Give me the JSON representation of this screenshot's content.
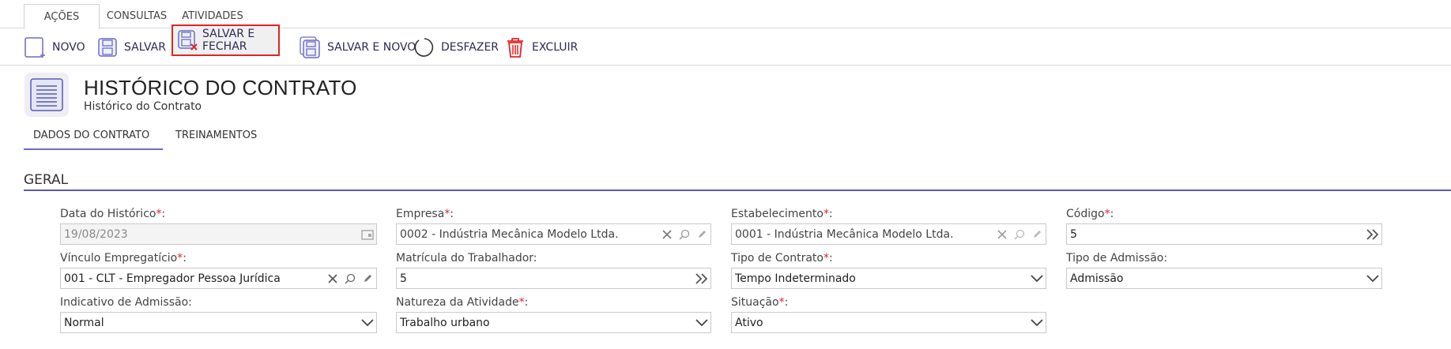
{
  "top_tabs": [
    "AÇÕES",
    "CONSULTAS",
    "ATIVIDADES"
  ],
  "toolbar": {
    "novo": "NOVO",
    "salvar": "SALVAR",
    "salvar_fechar": "SALVAR E FECHAR",
    "salvar_novo": "SALVAR E NOVO",
    "desfazer": "DESFAZER",
    "excluir": "EXCLUIR"
  },
  "header": {
    "title": "HISTÓRICO DO CONTRATO",
    "subtitle": "Histórico do Contrato"
  },
  "section_tabs": [
    "DADOS DO CONTRATO",
    "TREINAMENTOS"
  ],
  "section": {
    "title": "GERAL"
  },
  "required_mark": "*",
  "fields": {
    "data_historico": {
      "label": "Data do Histórico",
      "value": "19/08/2023"
    },
    "empresa": {
      "label": "Empresa",
      "value": "0002 - Indústria Mecânica Modelo Ltda."
    },
    "estabelecimento": {
      "label": "Estabelecimento",
      "value": "0001 - Indústria Mecânica Modelo Ltda."
    },
    "codigo": {
      "label": "Código",
      "value": "5"
    },
    "vinculo": {
      "label": "Vínculo Empregatício",
      "value": "001 - CLT - Empregador Pessoa Jurídica"
    },
    "matricula": {
      "label": "Matrícula do Trabalhador:",
      "value": "5"
    },
    "tipo_contrato": {
      "label": "Tipo de Contrato",
      "value": "Tempo Indeterminado"
    },
    "tipo_admissao": {
      "label": "Tipo de Admissão:",
      "value": "Admissão"
    },
    "indicativo_admissao": {
      "label": "Indicativo de Admissão:",
      "value": "Normal"
    },
    "natureza_atividade": {
      "label": "Natureza da Atividade",
      "value": "Trabalho urbano"
    },
    "situacao": {
      "label": "Situação",
      "value": "Ativo"
    }
  },
  "colors": {
    "accent": "#5a5ab0",
    "required": "#e02424",
    "highlight_border": "#e02424"
  }
}
